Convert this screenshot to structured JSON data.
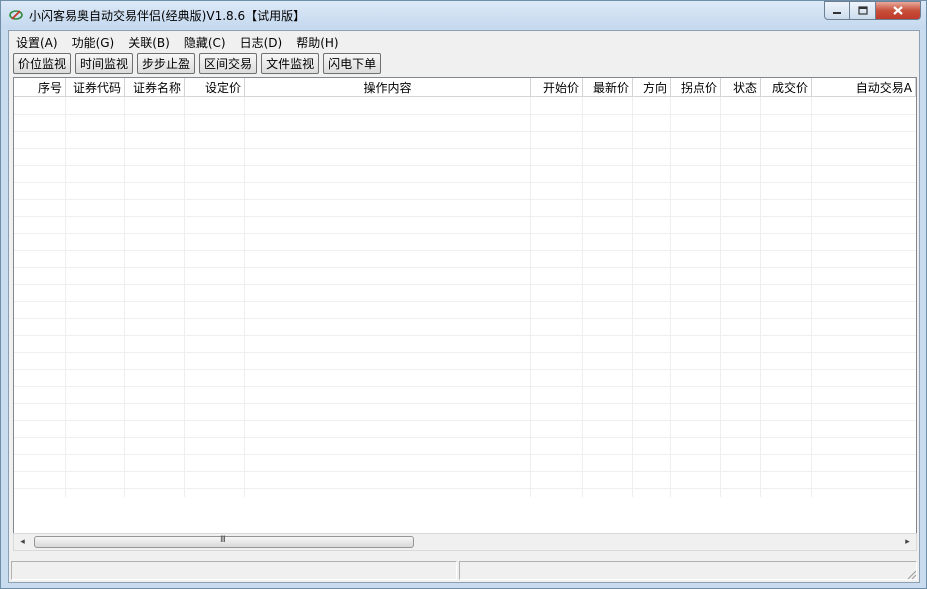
{
  "window": {
    "title": "小闪客易奥自动交易伴侣(经典版)V1.8.6【试用版】",
    "icons": {
      "app": "app-logo-icon",
      "minimize": "minimize-icon",
      "maximize": "maximize-icon",
      "close": "close-icon"
    }
  },
  "menu": [
    "设置(A)",
    "功能(G)",
    "关联(B)",
    "隐藏(C)",
    "日志(D)",
    "帮助(H)"
  ],
  "toolbar": [
    "价位监视",
    "时间监视",
    "步步止盈",
    "区间交易",
    "文件监视",
    "闪电下单"
  ],
  "table": {
    "columns": [
      "序号",
      "证券代码",
      "证券名称",
      "设定价",
      "操作内容",
      "开始价",
      "最新价",
      "方向",
      "拐点价",
      "状态",
      "成交价",
      "自动交易A"
    ],
    "rows": []
  },
  "scrollbar": {
    "left_arrow": "◂",
    "right_arrow": "▸",
    "grip": "III"
  },
  "statusbar": {
    "panels": [
      "",
      ""
    ]
  }
}
